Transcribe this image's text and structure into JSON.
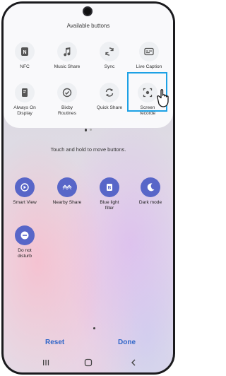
{
  "top_card": {
    "title": "Available buttons",
    "buttons": [
      {
        "label": "NFC",
        "icon": "nfc-icon"
      },
      {
        "label": "Music Share",
        "icon": "music-share-icon"
      },
      {
        "label": "Sync",
        "icon": "sync-icon"
      },
      {
        "label": "Live Caption",
        "icon": "live-caption-icon"
      },
      {
        "label": "Always On\nDisplay",
        "icon": "always-on-display-icon"
      },
      {
        "label": "Bixby\nRoutines",
        "icon": "bixby-routines-icon"
      },
      {
        "label": "Quick Share",
        "icon": "quick-share-icon"
      },
      {
        "label": "Screen\nrecorde",
        "icon": "screen-recorder-icon"
      }
    ]
  },
  "hint": "Touch and hold to move buttons.",
  "active_buttons": [
    {
      "label": "Smart View",
      "icon": "smart-view-icon"
    },
    {
      "label": "Nearby Share",
      "icon": "nearby-share-icon"
    },
    {
      "label": "Blue light\nfilter",
      "icon": "blue-light-filter-icon"
    },
    {
      "label": "Dark mode",
      "icon": "dark-mode-icon"
    },
    {
      "label": "Do not\ndisturb",
      "icon": "do-not-disturb-icon"
    }
  ],
  "actions": {
    "reset": "Reset",
    "done": "Done"
  },
  "colors": {
    "highlight": "#1da1e5",
    "active_icon_bg": "#5866c8",
    "action_text": "#2f66c8"
  }
}
